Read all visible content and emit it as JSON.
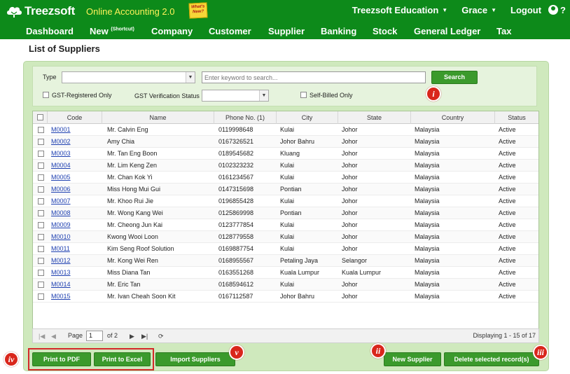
{
  "brand": {
    "name": "Treezsoft",
    "app": "Online Accounting 2.0",
    "whats_new": "What's New?"
  },
  "top_menu": {
    "company": "Treezsoft Education",
    "user": "Grace",
    "logout": "Logout",
    "help": "?"
  },
  "nav": [
    "Dashboard",
    "New",
    "Company",
    "Customer",
    "Supplier",
    "Banking",
    "Stock",
    "General Ledger",
    "Tax"
  ],
  "nav_shortcut": "(Shortcut)",
  "page_title": "List of Suppliers",
  "filters": {
    "type_label": "Type",
    "search_placeholder": "Enter keyword to search...",
    "search_button": "Search",
    "gst_registered": "GST-Registered Only",
    "gst_verification": "GST Verification Status",
    "self_billed": "Self-Billed Only"
  },
  "columns": [
    "Code",
    "Name",
    "Phone No. (1)",
    "City",
    "State",
    "Country",
    "Status"
  ],
  "rows": [
    {
      "code": "M0001",
      "name": "Mr. Calvin Eng",
      "phone": "0119998648",
      "city": "Kulai",
      "state": "Johor",
      "country": "Malaysia",
      "status": "Active"
    },
    {
      "code": "M0002",
      "name": "Amy Chia",
      "phone": "0167326521",
      "city": "Johor Bahru",
      "state": "Johor",
      "country": "Malaysia",
      "status": "Active"
    },
    {
      "code": "M0003",
      "name": "Mr. Tan Eng Boon",
      "phone": "0189545682",
      "city": "Kluang",
      "state": "Johor",
      "country": "Malaysia",
      "status": "Active"
    },
    {
      "code": "M0004",
      "name": "Mr. Lim Keng Zen",
      "phone": "0102323232",
      "city": "Kulai",
      "state": "Johor",
      "country": "Malaysia",
      "status": "Active"
    },
    {
      "code": "M0005",
      "name": "Mr. Chan Kok Yi",
      "phone": "0161234567",
      "city": "Kulai",
      "state": "Johor",
      "country": "Malaysia",
      "status": "Active"
    },
    {
      "code": "M0006",
      "name": "Miss Hong Mui Gui",
      "phone": "0147315698",
      "city": "Pontian",
      "state": "Johor",
      "country": "Malaysia",
      "status": "Active"
    },
    {
      "code": "M0007",
      "name": "Mr. Khoo Rui Jie",
      "phone": "0196855428",
      "city": "Kulai",
      "state": "Johor",
      "country": "Malaysia",
      "status": "Active"
    },
    {
      "code": "M0008",
      "name": "Mr. Wong Kang Wei",
      "phone": "0125869998",
      "city": "Pontian",
      "state": "Johor",
      "country": "Malaysia",
      "status": "Active"
    },
    {
      "code": "M0009",
      "name": "Mr. Cheong Jun Kai",
      "phone": "0123777854",
      "city": "Kulai",
      "state": "Johor",
      "country": "Malaysia",
      "status": "Active"
    },
    {
      "code": "M0010",
      "name": "Kwong Wooi Loon",
      "phone": "0128779558",
      "city": "Kulai",
      "state": "Johor",
      "country": "Malaysia",
      "status": "Active"
    },
    {
      "code": "M0011",
      "name": "Kim Seng Roof Solution",
      "phone": "0169887754",
      "city": "Kulai",
      "state": "Johor",
      "country": "Malaysia",
      "status": "Active"
    },
    {
      "code": "M0012",
      "name": "Mr. Kong Wei Ren",
      "phone": "0168955567",
      "city": "Petaling Jaya",
      "state": "Selangor",
      "country": "Malaysia",
      "status": "Active"
    },
    {
      "code": "M0013",
      "name": "Miss Diana Tan",
      "phone": "0163551268",
      "city": "Kuala Lumpur",
      "state": "Kuala Lumpur",
      "country": "Malaysia",
      "status": "Active"
    },
    {
      "code": "M0014",
      "name": "Mr. Eric Tan",
      "phone": "0168594612",
      "city": "Kulai",
      "state": "Johor",
      "country": "Malaysia",
      "status": "Active"
    },
    {
      "code": "M0015",
      "name": "Mr. Ivan Cheah Soon Kit",
      "phone": "0167112587",
      "city": "Johor Bahru",
      "state": "Johor",
      "country": "Malaysia",
      "status": "Active"
    }
  ],
  "pager": {
    "page_label": "Page",
    "page": "1",
    "of": "of 2",
    "display": "Displaying 1 - 15 of 17"
  },
  "buttons": {
    "print_pdf": "Print to PDF",
    "print_excel": "Print to Excel",
    "import": "Import Suppliers",
    "new_supplier": "New Supplier",
    "delete_selected": "Delete selected record(s)"
  },
  "markers": [
    "i",
    "ii",
    "iii",
    "iv",
    "v"
  ],
  "colors": {
    "brand_green": "#0d8a1a",
    "button_green": "#3b9a2c",
    "panel_green": "#cfe9bd",
    "marker_red": "#d9261c",
    "link_blue": "#1d3fb0"
  }
}
